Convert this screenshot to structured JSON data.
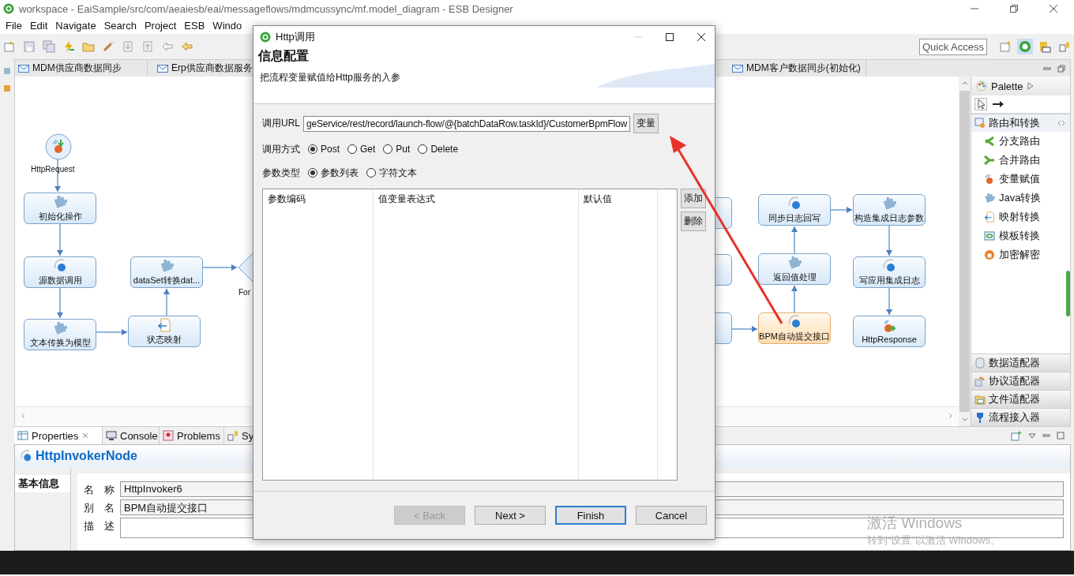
{
  "window": {
    "title": "workspace - EaiSample/src/com/aeaiesb/eai/messageflows/mdmcussync/mf.model_diagram - ESB Designer"
  },
  "menu": [
    "File",
    "Edit",
    "Navigate",
    "Search",
    "Project",
    "ESB",
    "Windo"
  ],
  "toolbar": {
    "quick_access": "Quick Access"
  },
  "editor_tabs": [
    {
      "label": "MDM供应商数据同步"
    },
    {
      "label": "Erp供应商数据服务"
    },
    {
      "label": "MDM客户数据同步(初始化)"
    }
  ],
  "diagram": {
    "nodes": [
      {
        "kind": "request",
        "label": "HttpRequest",
        "selected": false
      },
      {
        "kind": "java",
        "label": "初始化操作",
        "selected": false
      },
      {
        "kind": "http",
        "label": "源数据调用",
        "selected": false
      },
      {
        "kind": "java",
        "label": "文本传换为模型",
        "selected": false
      },
      {
        "kind": "mapping",
        "label": "状态映射",
        "selected": false
      },
      {
        "kind": "java",
        "label": "dataSet转换dat...",
        "selected": false
      },
      {
        "kind": "decision",
        "label": "For",
        "selected": false
      },
      {
        "kind": "blank",
        "selected": false
      },
      {
        "kind": "blank",
        "selected": false
      },
      {
        "kind": "blank",
        "selected": false
      },
      {
        "kind": "http",
        "label": "同步日志回写",
        "selected": false
      },
      {
        "kind": "java",
        "label": "构造集成日志参数",
        "selected": false
      },
      {
        "kind": "java",
        "label": "返回值处理",
        "selected": false
      },
      {
        "kind": "http",
        "label": "写应用集成日志",
        "selected": false
      },
      {
        "kind": "http",
        "label": "BPM自动提交接口",
        "selected": true
      },
      {
        "kind": "response",
        "label": "HttpResponse",
        "selected": false
      }
    ]
  },
  "palette": {
    "title": "Palette",
    "drawers": [
      {
        "kind": "route",
        "label": "路由和转换",
        "expanded": true,
        "items": [
          {
            "kind": "branch",
            "label": "分支路由"
          },
          {
            "kind": "merge",
            "label": "合并路由"
          },
          {
            "kind": "assign",
            "label": "变量赋值"
          },
          {
            "kind": "java",
            "label": "Java转换"
          },
          {
            "kind": "mapping",
            "label": "映射转换"
          },
          {
            "kind": "template",
            "label": "模板转换"
          },
          {
            "kind": "crypto",
            "label": "加密解密"
          }
        ]
      },
      {
        "kind": "data",
        "label": "数据适配器",
        "expanded": false
      },
      {
        "kind": "protocol",
        "label": "协议适配器",
        "expanded": false
      },
      {
        "kind": "file",
        "label": "文件适配器",
        "expanded": false
      },
      {
        "kind": "flow",
        "label": "流程接入器",
        "expanded": false
      }
    ]
  },
  "properties": {
    "tabs": [
      {
        "label": "Properties",
        "selected": true
      },
      {
        "label": "Console",
        "selected": false
      },
      {
        "label": "Problems",
        "selected": false
      },
      {
        "label": "Sy",
        "selected": false
      }
    ],
    "title": "HttpInvokerNode",
    "side_tab": "基本信息",
    "fields": [
      {
        "label": "名　称",
        "value": "HttpInvoker6"
      },
      {
        "label": "别　名",
        "value": "BPM自动提交接口"
      },
      {
        "label": "描　述"
      }
    ]
  },
  "dialog": {
    "title": "Http调用",
    "heading": "信息配置",
    "description": "把流程变量赋值给Http服务的入参",
    "url": {
      "label": "调用URL",
      "value": "geService/rest/record/launch-flow/@{batchDataRow.taskId}/CustomerBpmFlow",
      "button": "变量"
    },
    "method": {
      "label": "调用方式",
      "options": [
        {
          "label": "Post",
          "selected": true
        },
        {
          "label": "Get",
          "selected": false
        },
        {
          "label": "Put",
          "selected": false
        },
        {
          "label": "Delete",
          "selected": false
        }
      ]
    },
    "param_type": {
      "label": "参数类型",
      "options": [
        {
          "label": "参数列表",
          "selected": true
        },
        {
          "label": "字符文本",
          "selected": false
        }
      ]
    },
    "table": {
      "columns": [
        "参数编码",
        "值变量表达式",
        "默认值"
      ]
    },
    "side_buttons": [
      "添加",
      "删除"
    ],
    "buttons": [
      {
        "label": "< Back",
        "disabled": true,
        "default": false
      },
      {
        "label": "Next >",
        "disabled": false,
        "default": false
      },
      {
        "label": "Finish",
        "disabled": false,
        "default": true
      },
      {
        "label": "Cancel",
        "disabled": false,
        "default": false
      }
    ]
  },
  "os_notice": {
    "title": "激活 Windows",
    "text": "转到“设置”以激活 Windows。"
  }
}
